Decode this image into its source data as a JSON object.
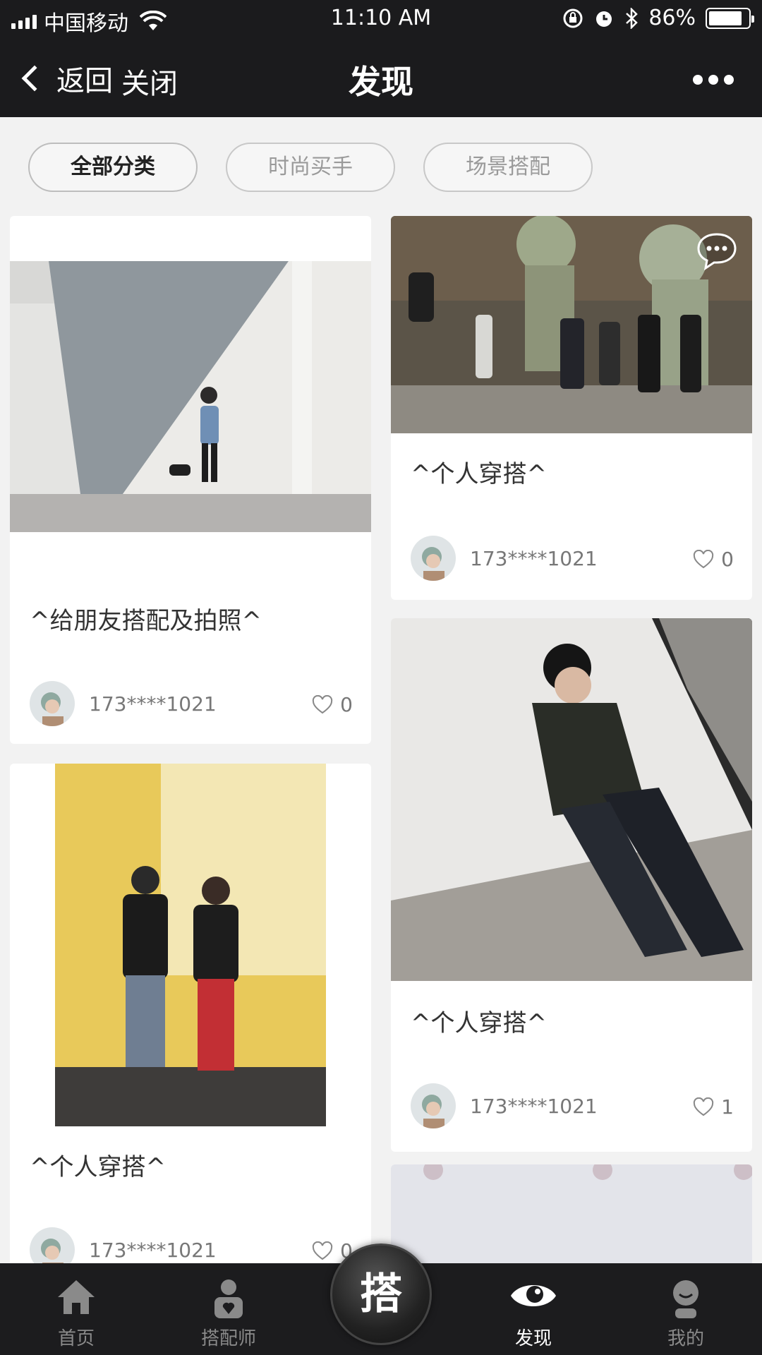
{
  "status_bar": {
    "carrier": "中国移动",
    "time": "11:10 AM",
    "battery": "86%",
    "battery_level": 0.86
  },
  "nav": {
    "back_label": "返回",
    "close_label": "关闭",
    "title": "发现"
  },
  "categories": [
    {
      "label": "全部分类",
      "active": true
    },
    {
      "label": "时尚买手",
      "active": false
    },
    {
      "label": "场景搭配",
      "active": false
    }
  ],
  "posts": [
    {
      "title": "^给朋友搭配及拍照^",
      "author": "173****1021",
      "likes": "0"
    },
    {
      "title": "^个人穿搭^",
      "author": "173****1021",
      "likes": "0"
    },
    {
      "title": "^个人穿搭^",
      "author": "173****1021",
      "likes": "0"
    },
    {
      "title": "^个人穿搭^",
      "author": "173****1021",
      "likes": "1"
    }
  ],
  "tabbar": {
    "home": "首页",
    "stylists": "搭配师",
    "center": "搭",
    "discover": "发现",
    "mine": "我的"
  },
  "colors": {
    "header_bg": "#1b1b1d",
    "tabbar_bg": "#1c1c1e",
    "page_bg": "#f2f2f2"
  }
}
